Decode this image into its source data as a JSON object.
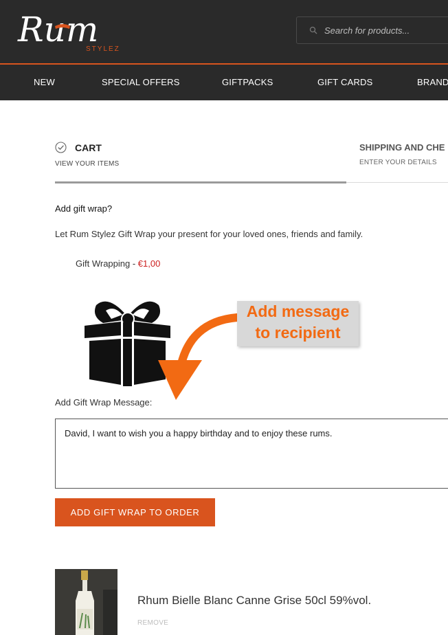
{
  "header": {
    "logo_text": "Rum",
    "logo_sub": "STYLEZ",
    "search_placeholder": "Search for products..."
  },
  "nav": {
    "items": [
      "NEW",
      "SPECIAL OFFERS",
      "GIFTPACKS",
      "GIFT CARDS",
      "BRAND"
    ]
  },
  "steps": [
    {
      "title": "CART",
      "subtitle": "VIEW YOUR ITEMS",
      "completed": true
    },
    {
      "title": "SHIPPING AND CHE",
      "subtitle": "ENTER YOUR DETAILS",
      "completed": false
    }
  ],
  "gift_wrap": {
    "heading": "Add gift wrap?",
    "description": "Let Rum Stylez Gift Wrap your present for your loved ones, friends and family.",
    "option_label": "Gift Wrapping - ",
    "option_price": "€1,00",
    "message_label": "Add Gift Wrap Message:",
    "message_value": "David, I want to wish you a happy birthday and to enjoy these rums.",
    "button_label": "ADD GIFT WRAP TO ORDER"
  },
  "annotation": {
    "line1": "Add message",
    "line2": "to recipient"
  },
  "product": {
    "name": "Rhum Bielle Blanc Canne Grise 50cl 59%vol.",
    "remove_label": "REMOVE"
  },
  "colors": {
    "header_bg": "#2a2a2a",
    "accent_orange": "#d9541e",
    "price_red": "#cc1f1f",
    "annotation_orange": "#f26a13"
  }
}
